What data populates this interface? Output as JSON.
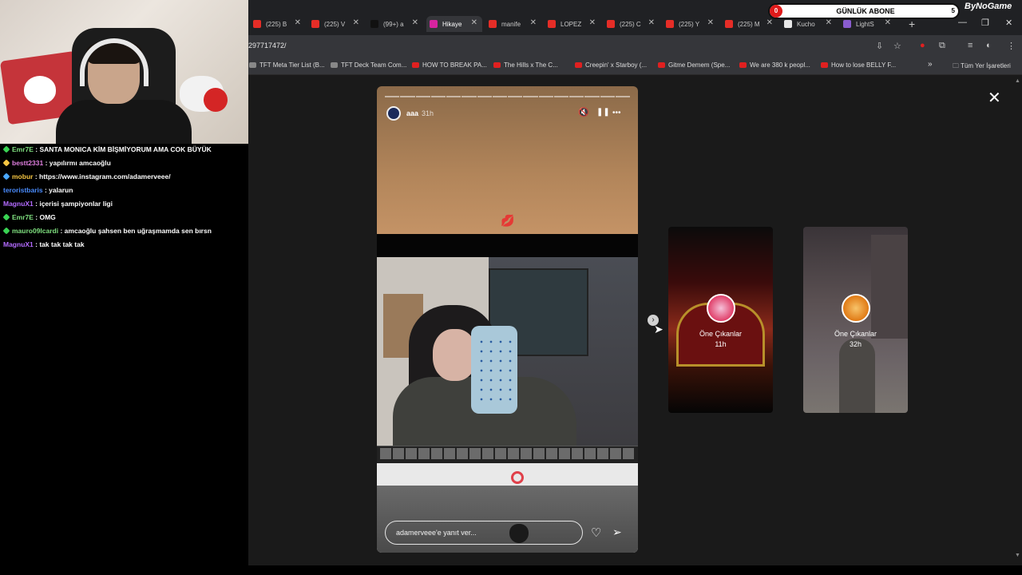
{
  "browser": {
    "tabs": [
      {
        "label": "(225) B",
        "color": "#e52d27",
        "active": false
      },
      {
        "label": "(225) V",
        "color": "#e52d27",
        "active": false
      },
      {
        "label": "(99+) a",
        "color": "#111111",
        "active": false
      },
      {
        "label": "Hikaye",
        "color": "#d6249f",
        "active": true
      },
      {
        "label": "manife",
        "color": "#e52d27",
        "active": false
      },
      {
        "label": "LOPEZ",
        "color": "#e52d27",
        "active": false
      },
      {
        "label": "(225) C",
        "color": "#e52d27",
        "active": false
      },
      {
        "label": "(225) Y",
        "color": "#e52d27",
        "active": false
      },
      {
        "label": "(225) M",
        "color": "#e52d27",
        "active": false
      },
      {
        "label": "Kucho",
        "color": "#e8e8e8",
        "active": false
      },
      {
        "label": "LightS",
        "color": "#8a5cd0",
        "active": false
      }
    ],
    "url": "297717472/",
    "bookmarks": [
      "TFT Meta Tier List (B...",
      "TFT Deck Team Com...",
      "HOW TO BREAK PA...",
      "The Hills x The C...",
      "Creepin' x Starboy (...",
      "Gitme Demem (Spe...",
      "We are 380 k peopl...",
      "How to lose BELLY F..."
    ],
    "bookmarks_overflow": "»",
    "bookmarks_folder": "Tüm Yer İşaretleri"
  },
  "overlay": {
    "sub_left_count": "0",
    "sub_label": "GÜNLÜK ABONE",
    "sub_right_count": "5",
    "brand": "ByNoGame"
  },
  "chat": [
    {
      "user": "Emr7E",
      "text": " : SANTA MONICA KİM BİŞMİYORUM AMA COK BÜYÜK",
      "color": "#7fe07f",
      "badge": "#39d353"
    },
    {
      "user": "bestt2331",
      "text": " : yapılırmı amcaoğlu",
      "color": "#e07fe0",
      "badge": "#f5c542"
    },
    {
      "user": "mobur",
      "text": " : https://www.instagram.com/adamerveee/",
      "color": "#f5c542",
      "badge": "#4aa8ff"
    },
    {
      "user": "teroristbaris",
      "text": " : yalarun",
      "color": "#4a8cff",
      "badge": ""
    },
    {
      "user": "MagnuX1",
      "text": " : içerisi şampiyonlar ligi",
      "color": "#b36bff",
      "badge": ""
    },
    {
      "user": "Emr7E",
      "text": " : OMG",
      "color": "#7fe07f",
      "badge": "#39d353"
    },
    {
      "user": "mauro09lcardi",
      "text": " : amcaoğlu şahsen ben uğraşmamda sen bırsn",
      "color": "#7fe07f",
      "badge": "#39d353"
    },
    {
      "user": "MagnuX1",
      "text": " : tak tak tak tak",
      "color": "#b36bff",
      "badge": ""
    }
  ],
  "story": {
    "username": "aaa",
    "time": "31h",
    "reply_placeholder": "adamerveee'e yanıt ver...",
    "emoji": "💋"
  },
  "previews": [
    {
      "label": "Öne Çıkanlar",
      "time": "11h"
    },
    {
      "label": "Öne Çıkanlar",
      "time": "32h"
    }
  ],
  "icons": {
    "mute": "🔇",
    "pause": "❚❚",
    "more": "•••",
    "heart": "♡",
    "send": "➢",
    "close": "✕",
    "next": "›",
    "new_tab": "+"
  }
}
